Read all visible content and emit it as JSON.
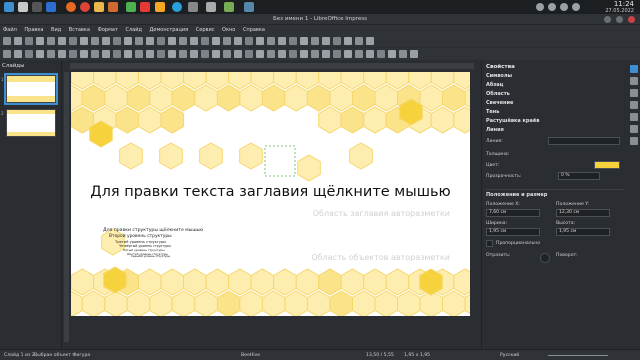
{
  "window": {
    "title": "Без имени 1 - LibreOffice Impress"
  },
  "clock": {
    "time": "11:24",
    "date": "27.05.2022"
  },
  "menu": [
    "Файл",
    "Правка",
    "Вид",
    "Вставка",
    "Формат",
    "Слайд",
    "Демонстрация",
    "Сервис",
    "Окно",
    "Справка"
  ],
  "slides_pane": {
    "title": "Слайды",
    "thumbs": [
      "1",
      "2"
    ]
  },
  "slide": {
    "title_text": "Для правки текста заглавия щёлкните мышью",
    "title_placeholder": "Область заглавия авторазметки",
    "body_placeholder": "Область объектов авторазметки",
    "outline": [
      "Для правки структуры щёлкните мышью",
      "Второй уровень структуры",
      "Третий уровень структуры",
      "Четвёртый уровень структуры",
      "Пятый уровень структуры",
      "Шестой уровень структуры",
      "Седьмой уровень структуры"
    ]
  },
  "sidebar": {
    "title": "Свойства",
    "sections": [
      "Символы",
      "Абзац",
      "Область",
      "Свечение",
      "Тень",
      "Растушёвка краёв"
    ],
    "line_section": "Линия",
    "line_label": "Линия:",
    "thickness_label": "Толщина:",
    "color_label": "Цвет:",
    "transparency_label": "Прозрачность:",
    "transparency_value": "0 %",
    "pos_section": "Положение и размер",
    "pos_x_label": "Положение X:",
    "pos_x_value": "7,60 см",
    "pos_y_label": "Положение Y:",
    "pos_y_value": "12,30 см",
    "width_label": "Ширина:",
    "width_value": "1,95 см",
    "height_label": "Высота:",
    "height_value": "1,95 см",
    "proportional_label": "Пропорционально",
    "flip_label": "Отразить:",
    "rotate_label": "Поворот:"
  },
  "status": {
    "slide": "Слайд 1 из 2",
    "selection": "Выбран объект Фигура",
    "theme": "BeeHive",
    "position": "13,50 / 5,55",
    "size": "1,95 x 1,95",
    "language": "Русский"
  },
  "colors": {
    "hex_light": "#fdeeb0",
    "hex_mid": "#fbe38a",
    "hex_dark": "#f6d33c",
    "hex_border": "#f5d76e",
    "accent": "#3d8fd1"
  }
}
